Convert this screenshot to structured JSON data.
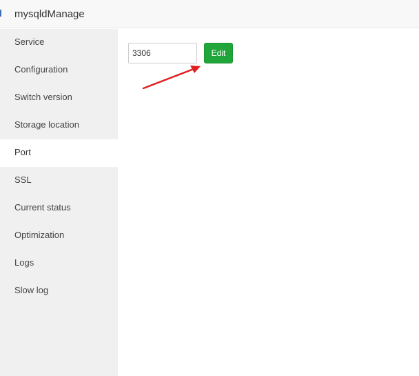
{
  "window": {
    "title": "mysqldManage"
  },
  "sidebar": {
    "items": [
      {
        "label": "Service",
        "active": false
      },
      {
        "label": "Configuration",
        "active": false
      },
      {
        "label": "Switch version",
        "active": false
      },
      {
        "label": "Storage location",
        "active": false
      },
      {
        "label": "Port",
        "active": true
      },
      {
        "label": "SSL",
        "active": false
      },
      {
        "label": "Current status",
        "active": false
      },
      {
        "label": "Optimization",
        "active": false
      },
      {
        "label": "Logs",
        "active": false
      },
      {
        "label": "Slow log",
        "active": false
      }
    ]
  },
  "port": {
    "value": "3306",
    "edit_label": "Edit"
  },
  "colors": {
    "accent_green": "#20a53a",
    "annotation_red": "#e02020",
    "sidebar_bg": "#f0f0f0"
  },
  "icons": {
    "annotation": "red-arrow-icon"
  }
}
